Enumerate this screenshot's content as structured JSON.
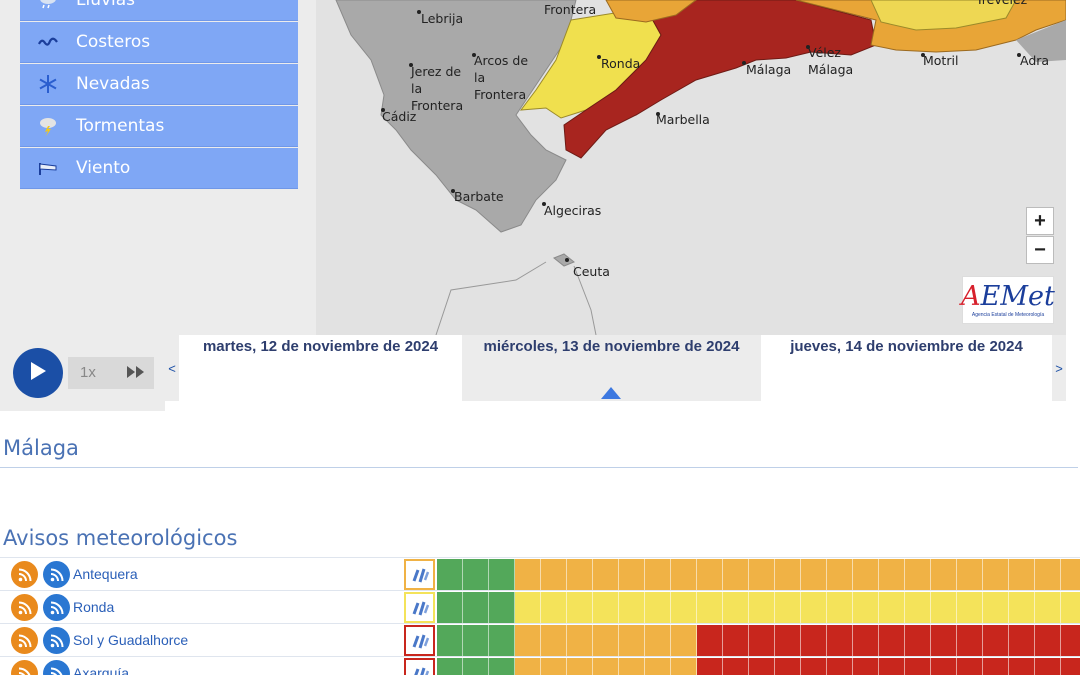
{
  "menu": {
    "items": [
      {
        "label": "Lluvias",
        "icon": "rain-cloud-icon"
      },
      {
        "label": "Costeros",
        "icon": "coastal-waves-icon"
      },
      {
        "label": "Nevadas",
        "icon": "snowflake-icon"
      },
      {
        "label": "Tormentas",
        "icon": "storm-cloud-icon"
      },
      {
        "label": "Viento",
        "icon": "wind-flag-icon"
      }
    ]
  },
  "map": {
    "cities": {
      "lebrija": "Lebrija",
      "frontera_top": "Frontera",
      "arcos": "Arcos de la Frontera",
      "jerez": "Jerez de la Frontera",
      "ronda": "Ronda",
      "malaga": "Málaga",
      "velez": "Vélez Málaga",
      "motril": "Motril",
      "adra": "Adra",
      "treveles": "Trevélez",
      "cadiz": "Cádiz",
      "marbella": "Marbella",
      "barbate": "Barbate",
      "algeciras": "Algeciras",
      "ceuta": "Ceuta"
    },
    "zoom_in": "+",
    "zoom_out": "−",
    "logo_text": "AEmet",
    "logo_subtext": "Agencia Estatal de Meteorología"
  },
  "player": {
    "speed": "1x",
    "prev_arrow": "<",
    "next_arrow": ">"
  },
  "days": [
    {
      "label": "martes, 12 de noviembre de 2024",
      "active": false
    },
    {
      "label": "miércoles, 13 de noviembre de 2024",
      "active": true
    },
    {
      "label": "jueves, 14 de noviembre de 2024",
      "active": false
    }
  ],
  "region": {
    "title": "Málaga"
  },
  "warnings": {
    "title": "Avisos meteorológicos",
    "colors": {
      "green": "#53a85a",
      "yellow": "#f4e35a",
      "orange": "#f0b245",
      "red": "#c8261d"
    },
    "rows": [
      {
        "zone": "Antequera",
        "level_color": "#f0b245",
        "cells": [
          "g",
          "g",
          "g",
          "o",
          "o",
          "o",
          "o",
          "o",
          "o",
          "o",
          "o",
          "o",
          "o",
          "o",
          "o",
          "o",
          "o",
          "o",
          "o",
          "o",
          "o",
          "o",
          "o",
          "o",
          "o"
        ]
      },
      {
        "zone": "Ronda",
        "level_color": "#f4e35a",
        "cells": [
          "g",
          "g",
          "g",
          "y",
          "y",
          "y",
          "y",
          "y",
          "y",
          "y",
          "y",
          "y",
          "y",
          "y",
          "y",
          "y",
          "y",
          "y",
          "y",
          "y",
          "y",
          "y",
          "y",
          "y",
          "y"
        ]
      },
      {
        "zone": "Sol y Guadalhorce",
        "level_color": "#c8261d",
        "cells": [
          "g",
          "g",
          "g",
          "o",
          "o",
          "o",
          "o",
          "o",
          "o",
          "o",
          "r",
          "r",
          "r",
          "r",
          "r",
          "r",
          "r",
          "r",
          "r",
          "r",
          "r",
          "r",
          "r",
          "r",
          "r"
        ]
      },
      {
        "zone": "Axarquía",
        "level_color": "#c8261d",
        "cells": [
          "g",
          "g",
          "g",
          "o",
          "o",
          "o",
          "o",
          "o",
          "o",
          "o",
          "r",
          "r",
          "r",
          "r",
          "r",
          "r",
          "r",
          "r",
          "r",
          "r",
          "r",
          "r",
          "r",
          "r",
          "r"
        ]
      }
    ]
  }
}
